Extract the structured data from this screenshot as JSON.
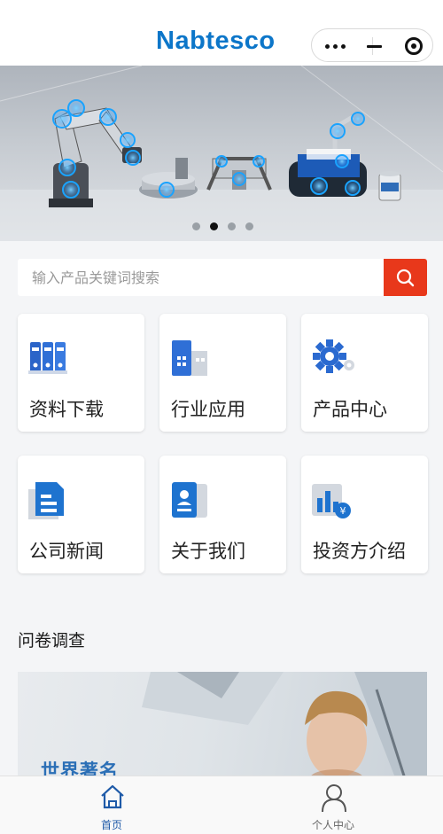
{
  "header": {
    "logo_text": "Nabtesco"
  },
  "banner": {
    "active_slide": 2,
    "slide_count": 4
  },
  "search": {
    "placeholder": "输入产品关键词搜索"
  },
  "tiles": [
    {
      "label": "资料下载",
      "icon": "binders-icon"
    },
    {
      "label": "行业应用",
      "icon": "building-icon"
    },
    {
      "label": "产品中心",
      "icon": "gear-icon"
    },
    {
      "label": "公司新闻",
      "icon": "document-icon"
    },
    {
      "label": "关于我们",
      "icon": "id-card-icon"
    },
    {
      "label": "投资方介绍",
      "icon": "chart-yen-icon"
    }
  ],
  "survey": {
    "title": "问卷调查",
    "card_headline": "世界著名"
  },
  "tabbar": {
    "home_label": "首页",
    "profile_label": "个人中心"
  },
  "colors": {
    "brand_blue": "#0c76c9",
    "search_red": "#e8381b",
    "active_tab": "#1e5aa8"
  }
}
